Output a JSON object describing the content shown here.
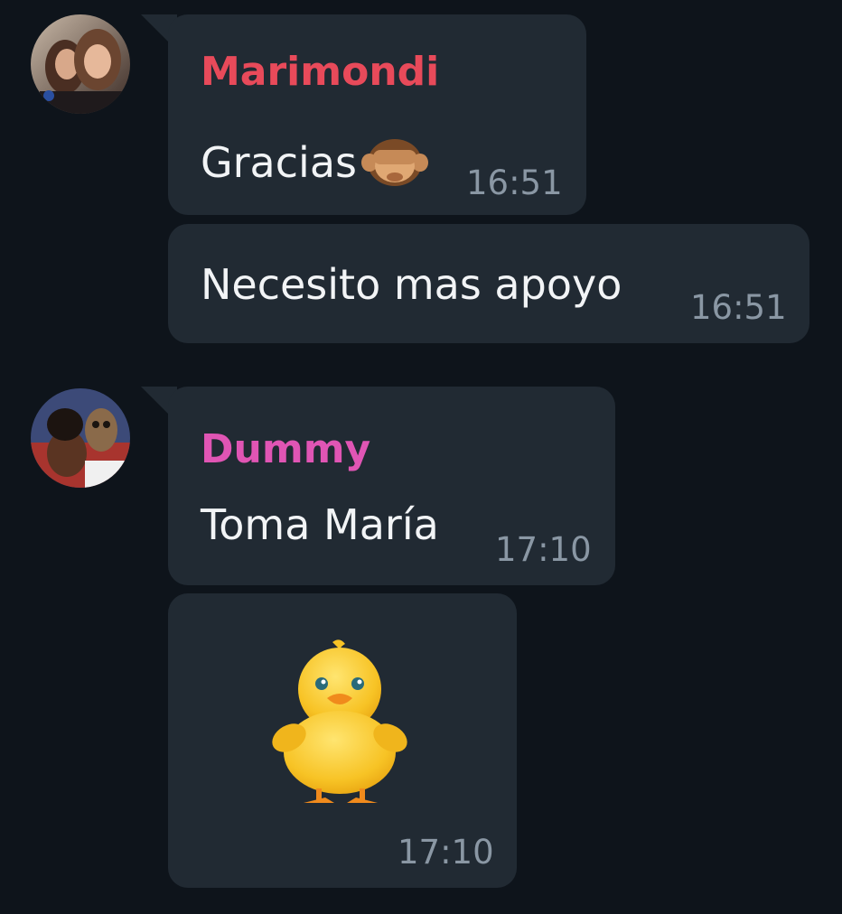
{
  "messages": [
    {
      "sender": "Marimondi",
      "sender_color": "#e84a5a",
      "avatar_icon": "avatar-marimondi",
      "text": "Gracias",
      "emoji": "see-no-evil-monkey",
      "time": "16:51"
    },
    {
      "text": "Necesito mas apoyo",
      "time": "16:51"
    },
    {
      "sender": "Dummy",
      "sender_color": "#e055b4",
      "avatar_icon": "avatar-dummy",
      "text": "Toma María",
      "time": "17:10"
    },
    {
      "sticker": "baby-chick",
      "time": "17:10"
    }
  ],
  "colors": {
    "background": "#0e141b",
    "bubble": "#212a33",
    "text": "#f2f4f6",
    "time": "#8a97a4"
  }
}
